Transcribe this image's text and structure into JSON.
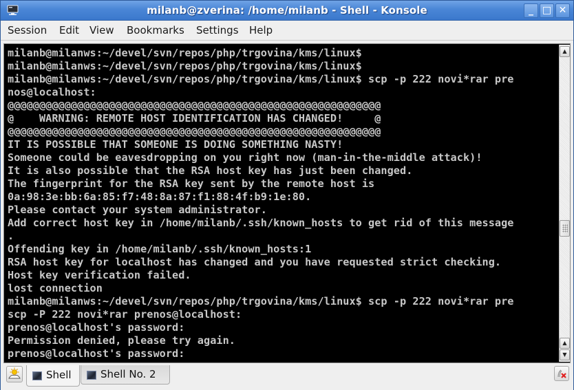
{
  "window": {
    "title": "milanb@zverina: /home/milanb - Shell - Konsole",
    "app_icon": "terminal-icon",
    "controls": {
      "minimize": "_",
      "maximize": "□",
      "close": "✕"
    }
  },
  "menubar": {
    "items": [
      "Session",
      "Edit",
      "View",
      "Bookmarks",
      "Settings",
      "Help"
    ]
  },
  "terminal": {
    "colors": {
      "background": "#000000",
      "foreground": "#c8c8c8"
    },
    "lines": [
      "milanb@milanws:~/devel/svn/repos/php/trgovina/kms/linux$",
      "milanb@milanws:~/devel/svn/repos/php/trgovina/kms/linux$",
      "milanb@milanws:~/devel/svn/repos/php/trgovina/kms/linux$ scp -p 222 novi*rar pre",
      "nos@localhost:",
      "@@@@@@@@@@@@@@@@@@@@@@@@@@@@@@@@@@@@@@@@@@@@@@@@@@@@@@@@@@@",
      "@    WARNING: REMOTE HOST IDENTIFICATION HAS CHANGED!     @",
      "@@@@@@@@@@@@@@@@@@@@@@@@@@@@@@@@@@@@@@@@@@@@@@@@@@@@@@@@@@@",
      "IT IS POSSIBLE THAT SOMEONE IS DOING SOMETHING NASTY!",
      "Someone could be eavesdropping on you right now (man-in-the-middle attack)!",
      "It is also possible that the RSA host key has just been changed.",
      "The fingerprint for the RSA key sent by the remote host is",
      "0a:98:3e:bb:6a:85:f7:48:8a:87:f1:88:4f:b9:1e:80.",
      "Please contact your system administrator.",
      "Add correct host key in /home/milanb/.ssh/known_hosts to get rid of this message",
      ".",
      "Offending key in /home/milanb/.ssh/known_hosts:1",
      "RSA host key for localhost has changed and you have requested strict checking.",
      "Host key verification failed.",
      "lost connection",
      "milanb@milanws:~/devel/svn/repos/php/trgovina/kms/linux$ scp -p 222 novi*rar pre",
      "scp -P 222 novi*rar prenos@localhost:",
      "prenos@localhost's password:",
      "Permission denied, please try again.",
      "prenos@localhost's password:"
    ]
  },
  "scrollbar": {
    "up_arrow": "▲",
    "down_arrow": "▼",
    "position_fraction": 0.62
  },
  "tabbar": {
    "new_session_icon": "new-session-icon",
    "tabs": [
      {
        "label": "Shell",
        "active": true
      },
      {
        "label": "Shell No. 2",
        "active": false
      }
    ],
    "close_session_icon": "close-session-icon"
  }
}
